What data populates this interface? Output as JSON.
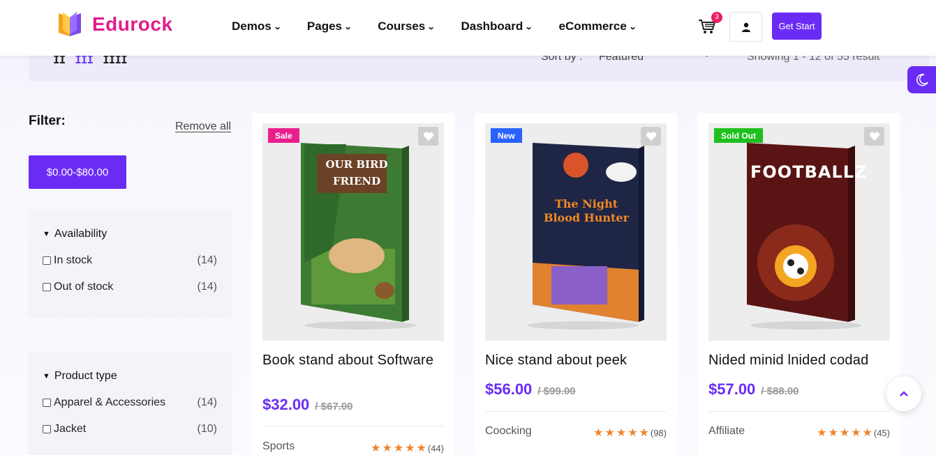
{
  "brand": {
    "name": "Edurock"
  },
  "nav": [
    {
      "label": "Demos"
    },
    {
      "label": "Pages"
    },
    {
      "label": "Courses"
    },
    {
      "label": "Dashboard"
    },
    {
      "label": "eCommerce"
    }
  ],
  "header": {
    "cart_count": "3",
    "cta_label": "Get Start"
  },
  "toolbar": {
    "sort_label": "Sort by :",
    "sort_value": "Featured",
    "showing_text": "Showing 1 - 12 of 55 result"
  },
  "filter": {
    "title": "Filter:",
    "remove_all": "Remove all",
    "price_chip": "$0.00-$80.00",
    "availability": {
      "title": "Availability",
      "options": [
        {
          "label": "In stock",
          "count": "(14)"
        },
        {
          "label": "Out of stock",
          "count": "(14)"
        }
      ]
    },
    "product_type": {
      "title": "Product type",
      "options": [
        {
          "label": "Apparel & Accessories",
          "count": "(14)"
        },
        {
          "label": "Jacket",
          "count": "(10)"
        }
      ]
    }
  },
  "products": [
    {
      "badge": "Sale",
      "badge_color": "#e91e8c",
      "cover_title": "OUR BIRD FRIEND",
      "title": "Book stand about Software",
      "price": "$32.00",
      "old_price": "/ $67.00",
      "category": "Sports",
      "reviews": "(44)"
    },
    {
      "badge": "New",
      "badge_color": "#2962ff",
      "cover_title": "The Night Blood Hunter",
      "title": "Nice stand about peek",
      "price": "$56.00",
      "old_price": "/ $99.00",
      "category": "Coocking",
      "reviews": "(98)"
    },
    {
      "badge": "Sold Out",
      "badge_color": "#1fbf1f",
      "cover_title": "FOOTBALLZ",
      "title": "Nided minid lnided codad",
      "price": "$57.00",
      "old_price": "/ $88.00",
      "category": "Affiliate",
      "reviews": "(45)"
    }
  ],
  "colors": {
    "accent": "#6a2cf5",
    "brand_pink": "#e11d8a",
    "star": "#f0842b"
  }
}
